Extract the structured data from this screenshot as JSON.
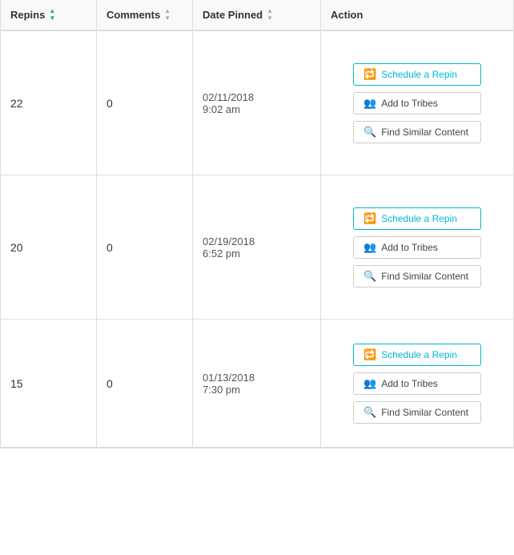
{
  "header": {
    "col_repins": "Repins",
    "col_comments": "Comments",
    "col_date": "Date Pinned",
    "col_action": "Action"
  },
  "rows": [
    {
      "repins": "22",
      "comments": "0",
      "date": "02/11/2018",
      "time": "9:02 am",
      "btn_schedule": "Schedule a Repin",
      "btn_tribes": "Add to Tribes",
      "btn_similar": "Find Similar Content"
    },
    {
      "repins": "20",
      "comments": "0",
      "date": "02/19/2018",
      "time": "6:52 pm",
      "btn_schedule": "Schedule a Repin",
      "btn_tribes": "Add to Tribes",
      "btn_similar": "Find Similar Content"
    },
    {
      "repins": "15",
      "comments": "0",
      "date": "01/13/2018",
      "time": "7:30 pm",
      "btn_schedule": "Schedule a Repin",
      "btn_tribes": "Add to Tribes",
      "btn_similar": "Find Similar Content"
    }
  ]
}
